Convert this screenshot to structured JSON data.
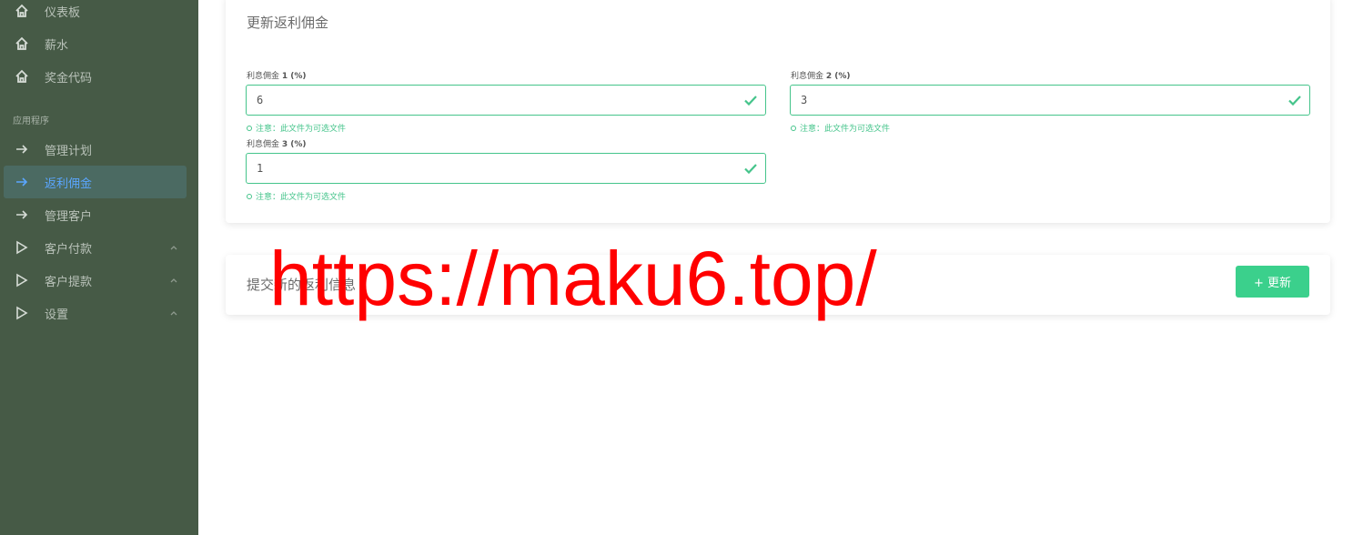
{
  "sidebar": {
    "items_top": [
      {
        "label": "仪表板",
        "icon": "home-icon"
      },
      {
        "label": "薪水",
        "icon": "home-icon"
      },
      {
        "label": "奖金代码",
        "icon": "home-icon"
      }
    ],
    "section_label": "应用程序",
    "items_app": [
      {
        "label": "管理计划",
        "icon": "arrow-right-icon"
      },
      {
        "label": "返利佣金",
        "icon": "arrow-right-icon",
        "active": true
      },
      {
        "label": "管理客户",
        "icon": "arrow-right-icon"
      },
      {
        "label": "客户付款",
        "icon": "play-icon",
        "expandable": true
      },
      {
        "label": "客户提款",
        "icon": "play-icon",
        "expandable": true
      },
      {
        "label": "设置",
        "icon": "play-icon",
        "expandable": true
      }
    ]
  },
  "form_card": {
    "title": "更新返利佣金",
    "fields": [
      {
        "label": "利息佣金",
        "label_suffix": "1 (%)",
        "value": "6",
        "hint": "注意：此文件为可选文件"
      },
      {
        "label": "利息佣金",
        "label_suffix": "2 (%)",
        "value": "3",
        "hint": "注意：此文件为可选文件"
      },
      {
        "label": "利息佣金",
        "label_suffix": "3 (%)",
        "value": "1",
        "hint": "注意：此文件为可选文件"
      }
    ]
  },
  "submit_card": {
    "title": "提交新的返利信息",
    "button_label": "+ 更新"
  },
  "watermark": "https://maku6.top/",
  "colors": {
    "sidebar_bg": "#465a46",
    "accent_green": "#45c48b",
    "button_green": "#3bd08c",
    "active_text": "#5aa6ff",
    "watermark": "#ff0000"
  }
}
